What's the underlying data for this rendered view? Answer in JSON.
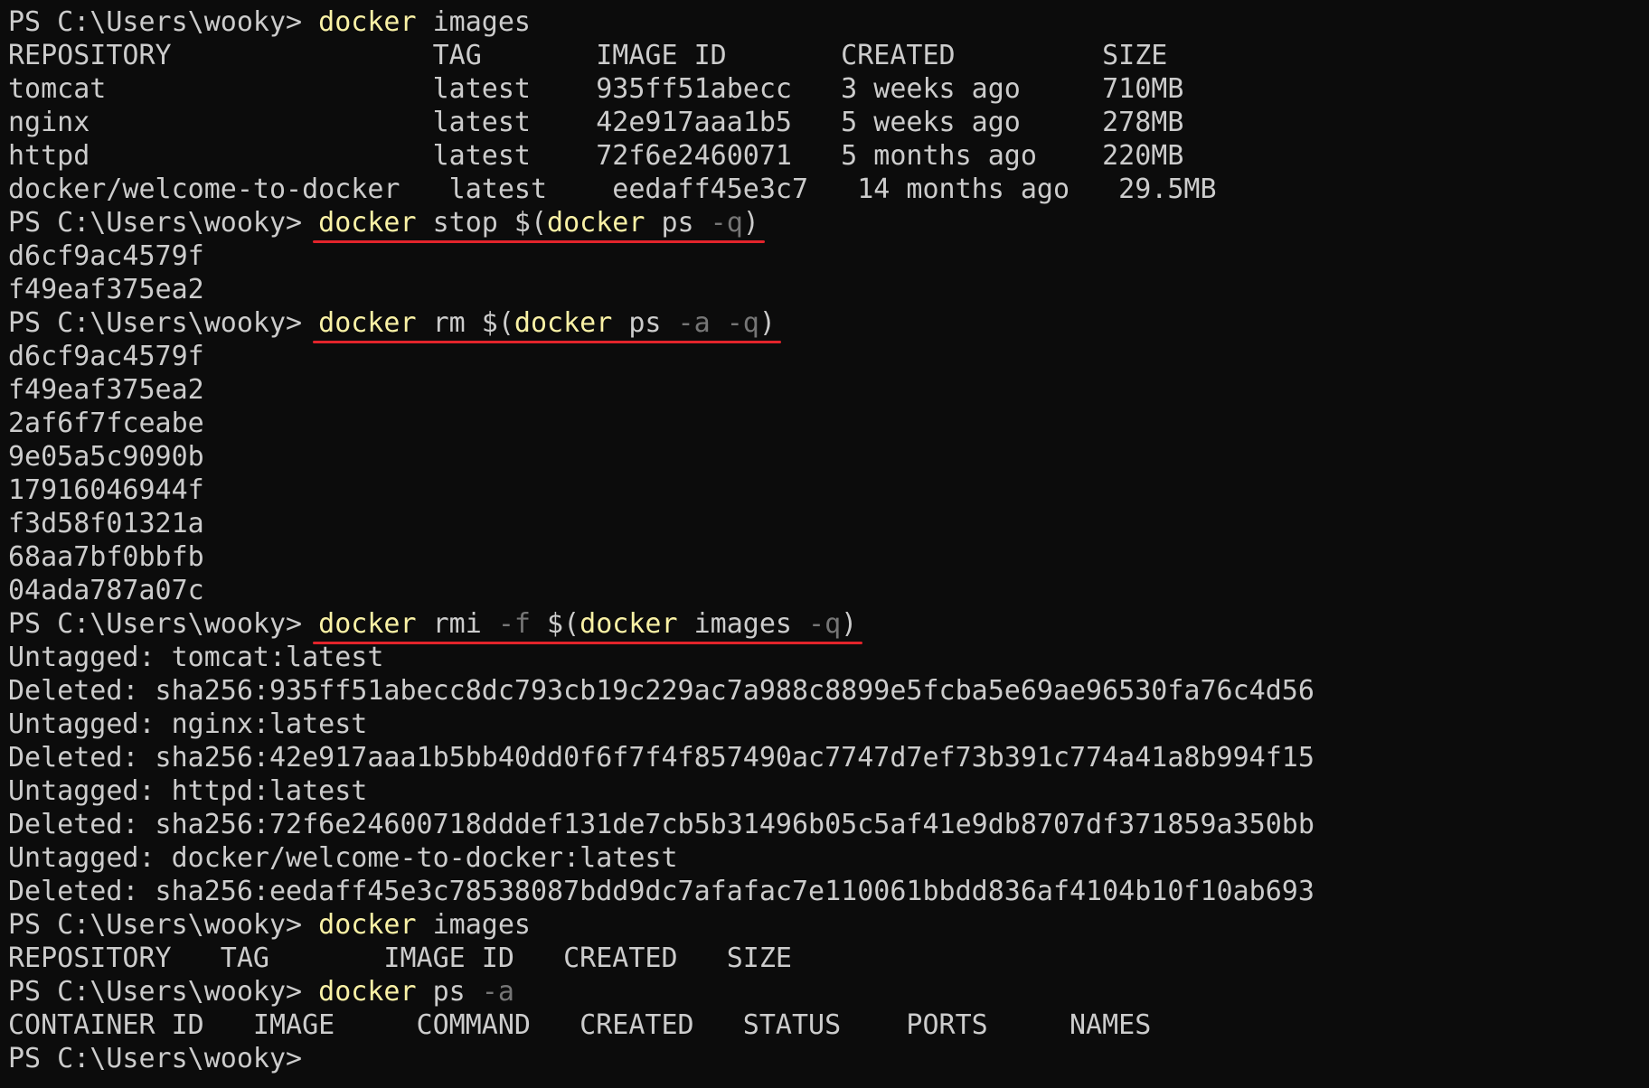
{
  "prompt": "PS C:\\Users\\wooky> ",
  "colors": {
    "background": "#0c0c0c",
    "text": "#cccccc",
    "command": "#f9f1a5",
    "parameter": "#767676",
    "annotation_underline": "#e3242b"
  },
  "lines": [
    {
      "type": "cmd",
      "underline": false,
      "tokens": [
        {
          "t": "docker",
          "c": "yellow"
        },
        {
          "t": " images",
          "c": "white"
        }
      ]
    },
    {
      "type": "out",
      "text": "REPOSITORY                TAG       IMAGE ID       CREATED         SIZE"
    },
    {
      "type": "out",
      "text": "tomcat                    latest    935ff51abecc   3 weeks ago     710MB"
    },
    {
      "type": "out",
      "text": "nginx                     latest    42e917aaa1b5   5 weeks ago     278MB"
    },
    {
      "type": "out",
      "text": "httpd                     latest    72f6e2460071   5 months ago    220MB"
    },
    {
      "type": "out",
      "text": "docker/welcome-to-docker   latest    eedaff45e3c7   14 months ago   29.5MB"
    },
    {
      "type": "cmd",
      "underline": true,
      "tokens": [
        {
          "t": "docker",
          "c": "yellow"
        },
        {
          "t": " stop $(",
          "c": "white"
        },
        {
          "t": "docker",
          "c": "yellow"
        },
        {
          "t": " ps ",
          "c": "white"
        },
        {
          "t": "-q",
          "c": "gray"
        },
        {
          "t": ")",
          "c": "white"
        }
      ]
    },
    {
      "type": "out",
      "text": "d6cf9ac4579f"
    },
    {
      "type": "out",
      "text": "f49eaf375ea2"
    },
    {
      "type": "cmd",
      "underline": true,
      "tokens": [
        {
          "t": "docker",
          "c": "yellow"
        },
        {
          "t": " rm $(",
          "c": "white"
        },
        {
          "t": "docker",
          "c": "yellow"
        },
        {
          "t": " ps ",
          "c": "white"
        },
        {
          "t": "-a",
          "c": "gray"
        },
        {
          "t": " ",
          "c": "white"
        },
        {
          "t": "-q",
          "c": "gray"
        },
        {
          "t": ")",
          "c": "white"
        }
      ]
    },
    {
      "type": "out",
      "text": "d6cf9ac4579f"
    },
    {
      "type": "out",
      "text": "f49eaf375ea2"
    },
    {
      "type": "out",
      "text": "2af6f7fceabe"
    },
    {
      "type": "out",
      "text": "9e05a5c9090b"
    },
    {
      "type": "out",
      "text": "17916046944f"
    },
    {
      "type": "out",
      "text": "f3d58f01321a"
    },
    {
      "type": "out",
      "text": "68aa7bf0bbfb"
    },
    {
      "type": "out",
      "text": "04ada787a07c"
    },
    {
      "type": "cmd",
      "underline": true,
      "tokens": [
        {
          "t": "docker",
          "c": "yellow"
        },
        {
          "t": " rmi ",
          "c": "white"
        },
        {
          "t": "-f",
          "c": "gray"
        },
        {
          "t": " $(",
          "c": "white"
        },
        {
          "t": "docker",
          "c": "yellow"
        },
        {
          "t": " images ",
          "c": "white"
        },
        {
          "t": "-q",
          "c": "gray"
        },
        {
          "t": ")",
          "c": "white"
        }
      ]
    },
    {
      "type": "out",
      "text": "Untagged: tomcat:latest"
    },
    {
      "type": "out",
      "text": "Deleted: sha256:935ff51abecc8dc793cb19c229ac7a988c8899e5fcba5e69ae96530fa76c4d56"
    },
    {
      "type": "out",
      "text": "Untagged: nginx:latest"
    },
    {
      "type": "out",
      "text": "Deleted: sha256:42e917aaa1b5bb40dd0f6f7f4f857490ac7747d7ef73b391c774a41a8b994f15"
    },
    {
      "type": "out",
      "text": "Untagged: httpd:latest"
    },
    {
      "type": "out",
      "text": "Deleted: sha256:72f6e24600718dddef131de7cb5b31496b05c5af41e9db8707df371859a350bb"
    },
    {
      "type": "out",
      "text": "Untagged: docker/welcome-to-docker:latest"
    },
    {
      "type": "out",
      "text": "Deleted: sha256:eedaff45e3c78538087bdd9dc7afafac7e110061bbdd836af4104b10f10ab693"
    },
    {
      "type": "cmd",
      "underline": false,
      "tokens": [
        {
          "t": "docker",
          "c": "yellow"
        },
        {
          "t": " images",
          "c": "white"
        }
      ]
    },
    {
      "type": "out",
      "text": "REPOSITORY   TAG       IMAGE ID   CREATED   SIZE"
    },
    {
      "type": "cmd",
      "underline": false,
      "tokens": [
        {
          "t": "docker",
          "c": "yellow"
        },
        {
          "t": " ps ",
          "c": "white"
        },
        {
          "t": "-a",
          "c": "gray"
        }
      ]
    },
    {
      "type": "out",
      "text": "CONTAINER ID   IMAGE     COMMAND   CREATED   STATUS    PORTS     NAMES"
    },
    {
      "type": "prompt"
    }
  ]
}
